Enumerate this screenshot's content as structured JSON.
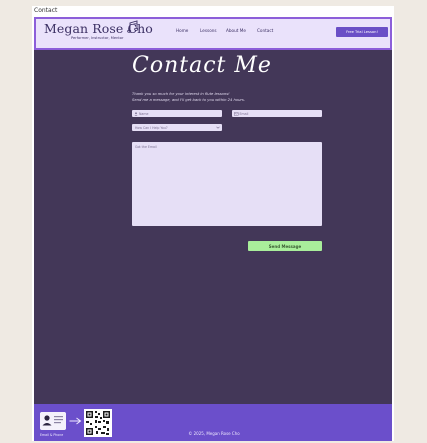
{
  "window": {
    "title": "Contact"
  },
  "header": {
    "brand": "Megan Rose Cho",
    "tagline": "Performer, Instructor, Mentor",
    "nav": [
      "Home",
      "Lessons",
      "About Me",
      "Contact"
    ],
    "cta": "Free Trial Lesson!"
  },
  "main": {
    "title": "Contact Me",
    "intro_line1": "Thank you so much for your interest in flute lessons!",
    "intro_line2": "Send me a message, and I'll get back to you within 24 hours.",
    "name_placeholder": "Name",
    "email_placeholder": "Email",
    "select_value": "How Can I Help You?",
    "message_placeholder": "Got the Email",
    "send_label": "Send Message"
  },
  "footer": {
    "card_label": "Email & Phone",
    "copyright": "© 2025, Megan Rose Cho"
  },
  "colors": {
    "background": "#433758",
    "header_bg": "#eae2fb",
    "header_border": "#8c5ed9",
    "accent": "#6a4fc6",
    "field_bg": "#e6dff6",
    "send_bg": "#a9ee9b",
    "footer_bg": "#6b4fcb"
  },
  "icons": [
    "music-note-icon",
    "user-icon",
    "mail-icon",
    "chevron-down-icon",
    "contact-card-icon",
    "arrow-right-icon",
    "qr-code-icon"
  ]
}
